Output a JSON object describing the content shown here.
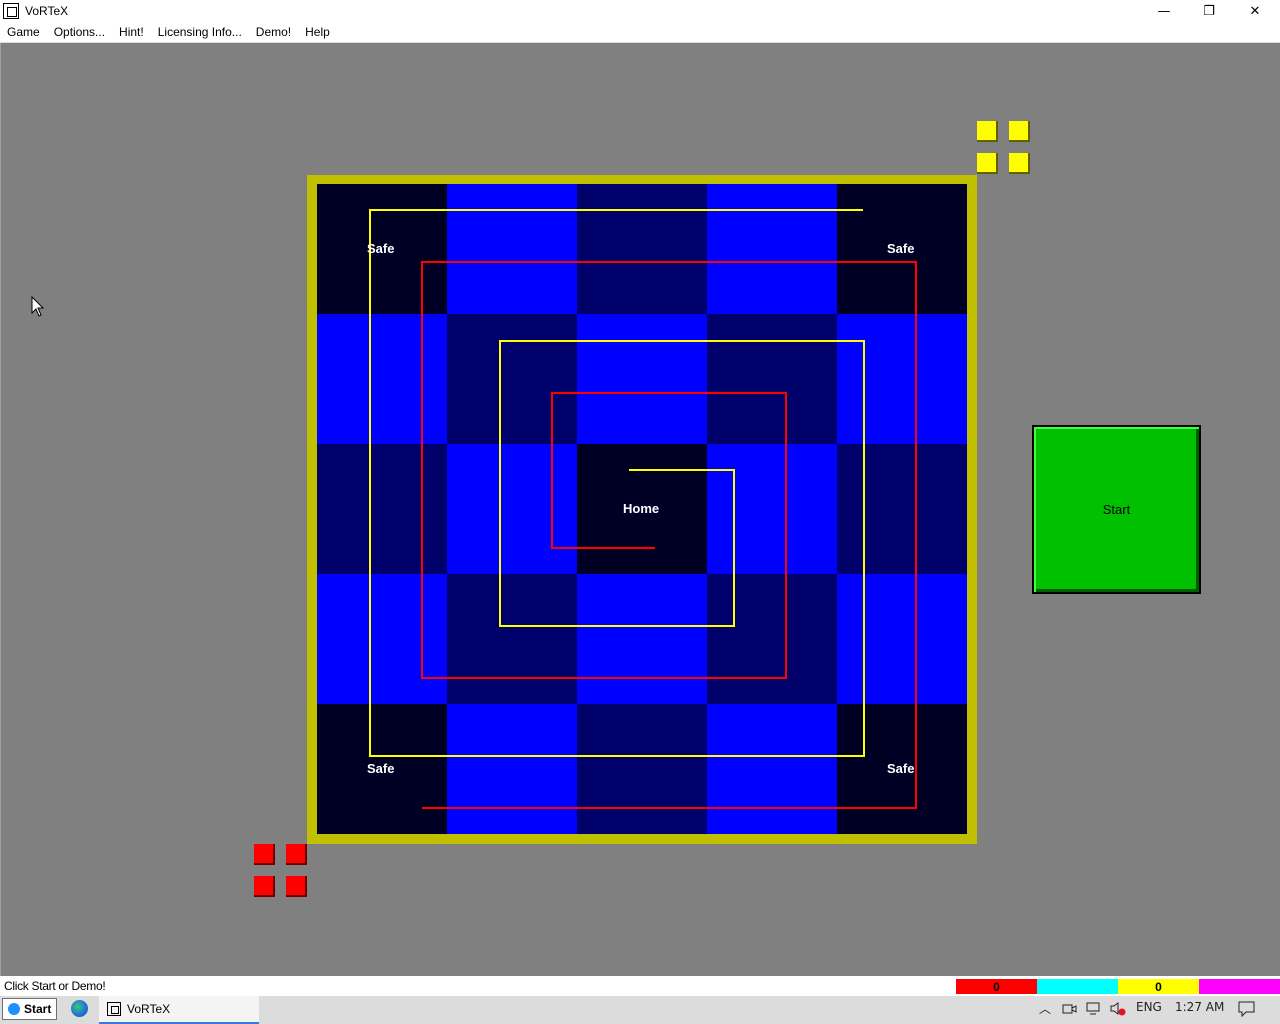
{
  "window": {
    "title": "VoRTeX",
    "minimize_glyph": "—",
    "restore_glyph": "❐",
    "close_glyph": "✕"
  },
  "menu": [
    "Game",
    "Options...",
    "Hint!",
    "Licensing Info...",
    "Demo!",
    "Help"
  ],
  "board": {
    "grid": [
      [
        "black",
        "blue",
        "navy",
        "blue",
        "black"
      ],
      [
        "blue",
        "navy",
        "blue",
        "navy",
        "blue"
      ],
      [
        "navy",
        "blue",
        "black",
        "blue",
        "navy"
      ],
      [
        "blue",
        "navy",
        "blue",
        "navy",
        "blue"
      ],
      [
        "black",
        "blue",
        "navy",
        "blue",
        "black"
      ]
    ],
    "home_label": "Home",
    "safe_labels": [
      "Safe",
      "Safe",
      "Safe",
      "Safe"
    ],
    "colors": {
      "frame": "#c0c000",
      "yellow_path": "#ffff00",
      "red_path": "#ff0000"
    }
  },
  "start_button": {
    "label": "Start",
    "color": "#00c000"
  },
  "tokens": {
    "yellow_count": 4,
    "red_count": 4,
    "yellow": "#ffff00",
    "red": "#ff0000"
  },
  "status": {
    "message": "Click Start or Demo!",
    "scores": [
      {
        "color": "#ff0000",
        "value": "0"
      },
      {
        "color": "#00ffff",
        "value": ""
      },
      {
        "color": "#ffff00",
        "value": "0"
      },
      {
        "color": "#ff00ff",
        "value": ""
      }
    ]
  },
  "taskbar": {
    "start_label": "Start",
    "app_label": "VoRTeX",
    "language": "ENG",
    "time": "1:27 AM"
  },
  "icons": [
    "app-icon",
    "minimize-icon",
    "restore-icon",
    "close-icon",
    "windows-logo-icon",
    "edge-icon",
    "tray-chevron-icon",
    "camera-icon",
    "network-icon",
    "volume-muted-icon",
    "notification-icon",
    "mouse-cursor-icon"
  ]
}
